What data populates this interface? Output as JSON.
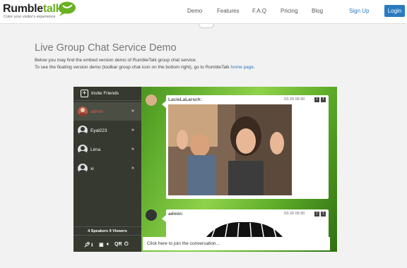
{
  "brand": {
    "name_dark": "Rumble",
    "name_green": "talk",
    "tagline": "Color your visitor's experience",
    "green": "#6ab023"
  },
  "nav": {
    "items": [
      "Demo",
      "Features",
      "F.A.Q",
      "Pricing",
      "Blog"
    ],
    "signup": "Sign Up",
    "login": "Login",
    "accent": "#2a7abf"
  },
  "page": {
    "title": "Live Group Chat Service Demo",
    "line1": "Below you may find the embed version demo of RumbleTalk group chat service.",
    "line2_prefix": "To see the floating version demo (toolbar group chat icon on the bottom right), go to RumbleTalk ",
    "line2_link": "home page",
    "line2_suffix": "."
  },
  "chat": {
    "invite_label": "Invite Friends",
    "users": [
      {
        "name": "admin",
        "highlight": true
      },
      {
        "name": "Eyal223",
        "highlight": false
      },
      {
        "name": "Lima",
        "highlight": false
      },
      {
        "name": "xi",
        "highlight": false
      }
    ],
    "arrow": "»",
    "counts": "4 Speakers  9 Viewers",
    "toolbar_icons": [
      "pin-icon",
      "download-icon",
      "window-icon",
      "volume-icon",
      "qr-icon",
      "power-icon"
    ],
    "qr_label": "QR",
    "messages": [
      {
        "sender": "LacieLaLarsch:",
        "time": "03-20 09:30"
      },
      {
        "sender": "admin:",
        "time": "03-20 09:30"
      }
    ],
    "share_t": "t",
    "share_f": "f",
    "join_prompt": "Click here to join the conversation..."
  }
}
